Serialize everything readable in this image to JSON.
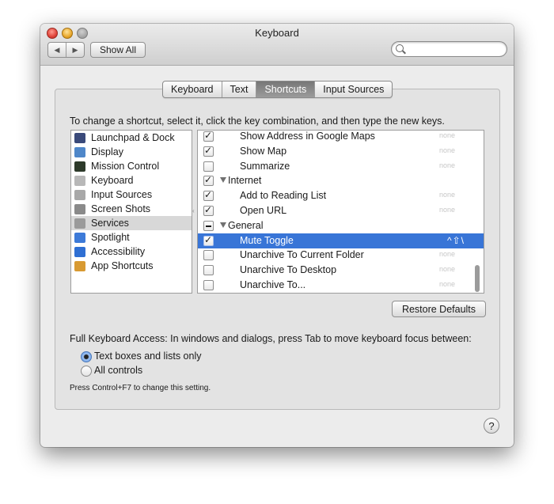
{
  "window": {
    "title": "Keyboard"
  },
  "toolbar": {
    "back": "◀",
    "forward": "▶",
    "show_all": "Show All",
    "search_placeholder": ""
  },
  "tabs": [
    {
      "label": "Keyboard",
      "selected": false
    },
    {
      "label": "Text",
      "selected": false
    },
    {
      "label": "Shortcuts",
      "selected": true
    },
    {
      "label": "Input Sources",
      "selected": false
    }
  ],
  "instructions": "To change a shortcut, select it, click the key combination, and then type the new keys.",
  "categories": [
    {
      "label": "Launchpad & Dock",
      "icon": "launchpad-icon",
      "color": "#3a4a7a"
    },
    {
      "label": "Display",
      "icon": "display-icon",
      "color": "#4f87c9"
    },
    {
      "label": "Mission Control",
      "icon": "mission-control-icon",
      "color": "#2d3a2a"
    },
    {
      "label": "Keyboard",
      "icon": "keyboard-icon",
      "color": "#b8b8b8"
    },
    {
      "label": "Input Sources",
      "icon": "input-sources-icon",
      "color": "#a8a8a8"
    },
    {
      "label": "Screen Shots",
      "icon": "screenshot-icon",
      "color": "#8a8a8a"
    },
    {
      "label": "Services",
      "icon": "gear-icon",
      "color": "#9a9a9a",
      "selected": true
    },
    {
      "label": "Spotlight",
      "icon": "spotlight-icon",
      "color": "#3d7ad8"
    },
    {
      "label": "Accessibility",
      "icon": "accessibility-icon",
      "color": "#2f6fd3"
    },
    {
      "label": "App Shortcuts",
      "icon": "app-shortcuts-icon",
      "color": "#d89a32"
    }
  ],
  "shortcuts": [
    {
      "label": "Show Address in Google Maps",
      "state": "checked",
      "indent": 2,
      "key": "none"
    },
    {
      "label": "Show Map",
      "state": "checked",
      "indent": 2,
      "key": "none"
    },
    {
      "label": "Summarize",
      "state": "unchecked",
      "indent": 2,
      "key": "none"
    },
    {
      "label": "Internet",
      "state": "checked",
      "indent": 1,
      "group": true,
      "key": ""
    },
    {
      "label": "Add to Reading List",
      "state": "checked",
      "indent": 2,
      "key": "none"
    },
    {
      "label": "Open URL",
      "state": "checked",
      "indent": 2,
      "key": "none"
    },
    {
      "label": "General",
      "state": "mixed",
      "indent": 1,
      "group": true,
      "key": ""
    },
    {
      "label": "Mute Toggle",
      "state": "checked",
      "indent": 2,
      "key": "^⇧\\",
      "selected": true
    },
    {
      "label": "Unarchive To Current Folder",
      "state": "unchecked",
      "indent": 2,
      "key": "none"
    },
    {
      "label": "Unarchive To Desktop",
      "state": "unchecked",
      "indent": 2,
      "key": "none"
    },
    {
      "label": "Unarchive To...",
      "state": "unchecked",
      "indent": 2,
      "key": "none"
    }
  ],
  "restore_defaults": "Restore Defaults",
  "full_keyboard_access": {
    "description": "Full Keyboard Access: In windows and dialogs, press Tab to move keyboard focus between:",
    "options": [
      {
        "label": "Text boxes and lists only",
        "selected": true
      },
      {
        "label": "All controls",
        "selected": false
      }
    ],
    "hint": "Press Control+F7 to change this setting."
  },
  "help": "?"
}
